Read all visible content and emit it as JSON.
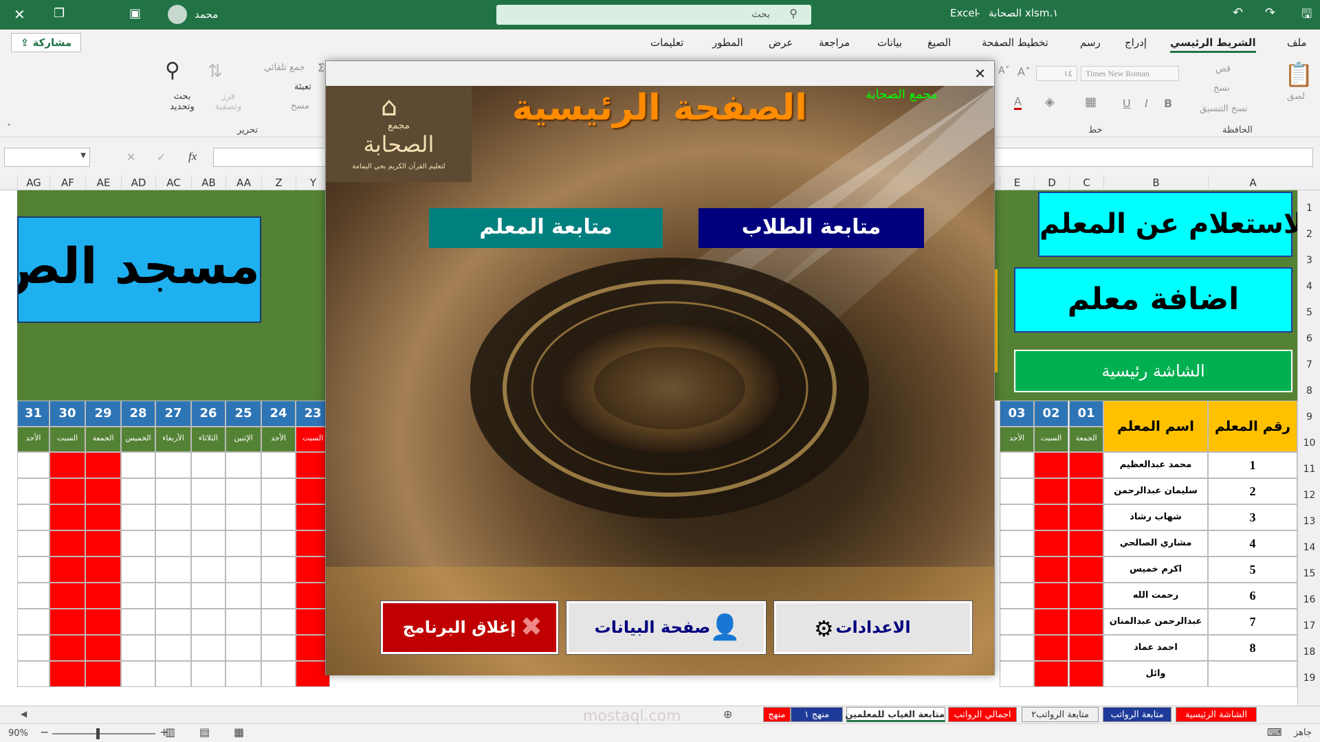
{
  "window": {
    "app": "Excel",
    "file": "الصحابة xlsm.١",
    "user": "محمد",
    "search_placeholder": "بحث"
  },
  "share": "مشاركة",
  "ribbon_tabs": [
    "ملف",
    "الشريط الرئيسي",
    "إدراج",
    "رسم",
    "تخطيط الصفحة",
    "الصيغ",
    "بيانات",
    "مراجعة",
    "عرض",
    "المطور",
    "تعليمات"
  ],
  "ribbon": {
    "paste": "لصق",
    "cut": "قص",
    "copy": "نسخ",
    "format_painter": "نسخ التنسيق",
    "clipboard": "الحافظة",
    "font_name": "Times New Roman",
    "font_size": "١٤",
    "font_group": "خط",
    "autosum": "جمع تلقائي",
    "fill": "تعبئة",
    "clear": "مسح",
    "sort": "فرز وتصفية",
    "find": "بحث وتحديد",
    "edit_group": "تحرير"
  },
  "formula": {
    "fx": "fx"
  },
  "columns": [
    "A",
    "B",
    "C",
    "D",
    "E",
    "Y",
    "Z",
    "AA",
    "AB",
    "AC",
    "AD",
    "AE",
    "AF",
    "AG"
  ],
  "rows": [
    "1",
    "2",
    "3",
    "4",
    "5",
    "6",
    "7",
    "8",
    "9",
    "10",
    "11",
    "12",
    "13",
    "14",
    "15",
    "16",
    "17",
    "18",
    "19"
  ],
  "sheet": {
    "inquire_btn": "الاستعلام عن المعلم",
    "add_btn": "اضافة معلم",
    "home_btn": "الشاشة رئيسية",
    "mosque": "مسجد الص",
    "col_num": "رقم المعلم",
    "col_name": "اسم المعلم",
    "days_right": [
      "01",
      "02",
      "03"
    ],
    "daynames_right": [
      "الجمعة",
      "السبت",
      "الأحد"
    ],
    "days_left": [
      "23",
      "24",
      "25",
      "26",
      "27",
      "28",
      "29",
      "30",
      "31"
    ],
    "daynames_left": [
      "السبت",
      "الأحد",
      "الإثنين",
      "الثلاثاء",
      "الأربعاء",
      "الخميس",
      "الجمعة",
      "السبت",
      "الأحد"
    ],
    "teachers": [
      {
        "num": "1",
        "name": "محمد عبدالعظيم"
      },
      {
        "num": "2",
        "name": "سليمان عبدالرحمن"
      },
      {
        "num": "3",
        "name": "شهاب رشاد"
      },
      {
        "num": "4",
        "name": "مشاري الصالحي"
      },
      {
        "num": "5",
        "name": "اكرم خميس"
      },
      {
        "num": "6",
        "name": "رحمت الله"
      },
      {
        "num": "7",
        "name": "عبدالرحمن عبدالمنان"
      },
      {
        "num": "8",
        "name": "احمد عماد"
      },
      {
        "num": "",
        "name": "وائل"
      }
    ]
  },
  "dialog": {
    "title": "الصفحة الرئيسية",
    "complex": "مجمع الصحابة",
    "logo_top": "مجمع",
    "logo_main": "الصحابة",
    "logo_sub": "لتعليم القرآن الكريم بحي اليمامة",
    "btn_students": "متابعة الطلاب",
    "btn_teachers": "متابعة المعلم",
    "btn_settings": "الاعدادات",
    "btn_data": "صفحة البيانات",
    "btn_close": "إغلاق البرنامج"
  },
  "tabs": [
    {
      "label": "الشاشة الرئيسية",
      "color": "#ff0000"
    },
    {
      "label": "متابعة الرواتب",
      "color": "#1f3b99"
    },
    {
      "label": "متابعة الرواتب٢",
      "color": "#f0f0f0"
    },
    {
      "label": "اجمالي الرواتب",
      "color": "#ff0000"
    },
    {
      "label": "متابعة الغياب للمعلمين",
      "color": "#ffffff"
    },
    {
      "label": "منهج ١",
      "color": "#1f3b99"
    },
    {
      "label": "منهج",
      "color": "#ff0000"
    }
  ],
  "status": {
    "ready": "جاهز",
    "zoom": "90%"
  },
  "watermark": "mostaql.com"
}
